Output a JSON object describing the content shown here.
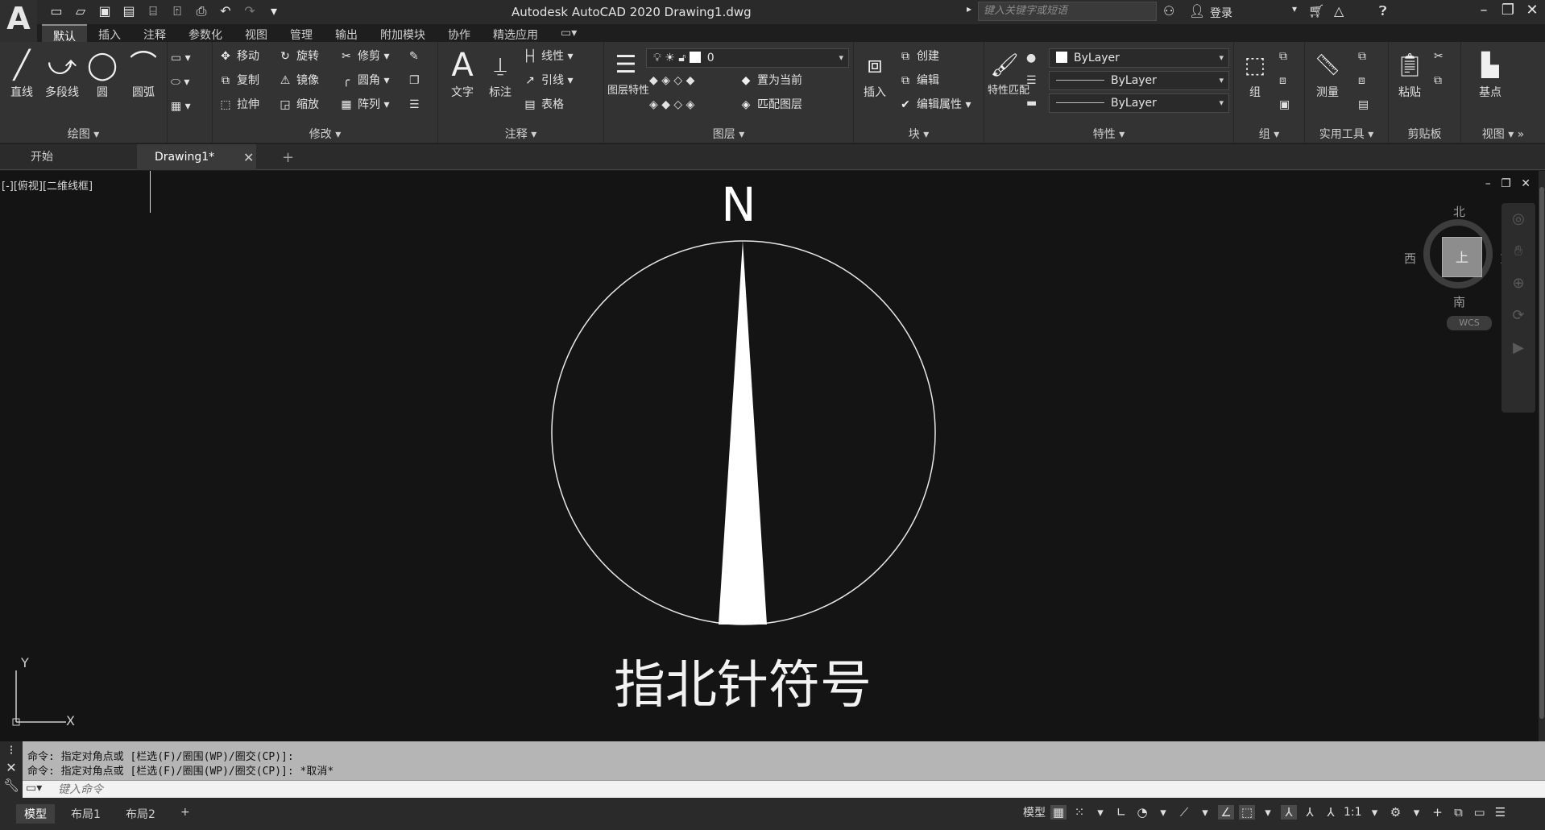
{
  "titlebar": {
    "app_logo": "A",
    "title": "Autodesk AutoCAD 2020    Drawing1.dwg",
    "search_placeholder": "键入关键字或短语",
    "login": "登录"
  },
  "ribbon_tabs": [
    "默认",
    "插入",
    "注释",
    "参数化",
    "视图",
    "管理",
    "输出",
    "附加模块",
    "协作",
    "精选应用"
  ],
  "ribbon": {
    "draw": {
      "title": "绘图",
      "tools": [
        "直线",
        "多段线",
        "圆",
        "圆弧"
      ]
    },
    "modify": {
      "title": "修改",
      "tools": [
        "移动",
        "旋转",
        "修剪",
        "复制",
        "镜像",
        "圆角",
        "拉伸",
        "缩放",
        "阵列"
      ]
    },
    "annotation": {
      "title": "注释",
      "text": "文字",
      "dimension": "标注",
      "linear": "线性",
      "leader": "引线",
      "table": "表格"
    },
    "layers": {
      "title": "图层",
      "layer_props": "图层特性",
      "current_layer": "0",
      "set_current": "置为当前",
      "match_layer": "匹配图层"
    },
    "block": {
      "title": "块",
      "insert": "插入",
      "create": "创建",
      "edit": "编辑",
      "edit_attr": "编辑属性"
    },
    "properties": {
      "title": "特性",
      "match": "特性匹配",
      "color": "ByLayer",
      "lineweight": "ByLayer",
      "linetype": "ByLayer"
    },
    "groups": {
      "title": "组",
      "group": "组"
    },
    "utilities": {
      "title": "实用工具",
      "measure": "测量"
    },
    "clipboard": {
      "title": "剪贴板",
      "paste": "粘贴"
    },
    "view": {
      "title": "视图",
      "base": "基点"
    }
  },
  "doc_tabs": {
    "start": "开始",
    "drawing": "Drawing1*"
  },
  "viewport": {
    "label": "[-][俯视][二维线框]",
    "north_letter": "N",
    "caption": "指北针符号",
    "ucs_y": "Y",
    "ucs_x": "X"
  },
  "viewcube": {
    "north": "北",
    "south": "南",
    "east": "东",
    "west": "西",
    "face": "上",
    "wcs": "WCS"
  },
  "command": {
    "history": [
      "命令: 指定对角点或 [栏选(F)/圈围(WP)/圈交(CP)]:",
      "命令: 指定对角点或 [栏选(F)/圈围(WP)/圈交(CP)]: *取消*"
    ],
    "placeholder": "键入命令"
  },
  "status": {
    "layouts": [
      "模型",
      "布局1",
      "布局2"
    ],
    "model": "模型",
    "scale": "1:1"
  },
  "colors": {
    "canvas": "#141414",
    "ribbon": "#333333",
    "command_history": "#b5b5b5"
  }
}
